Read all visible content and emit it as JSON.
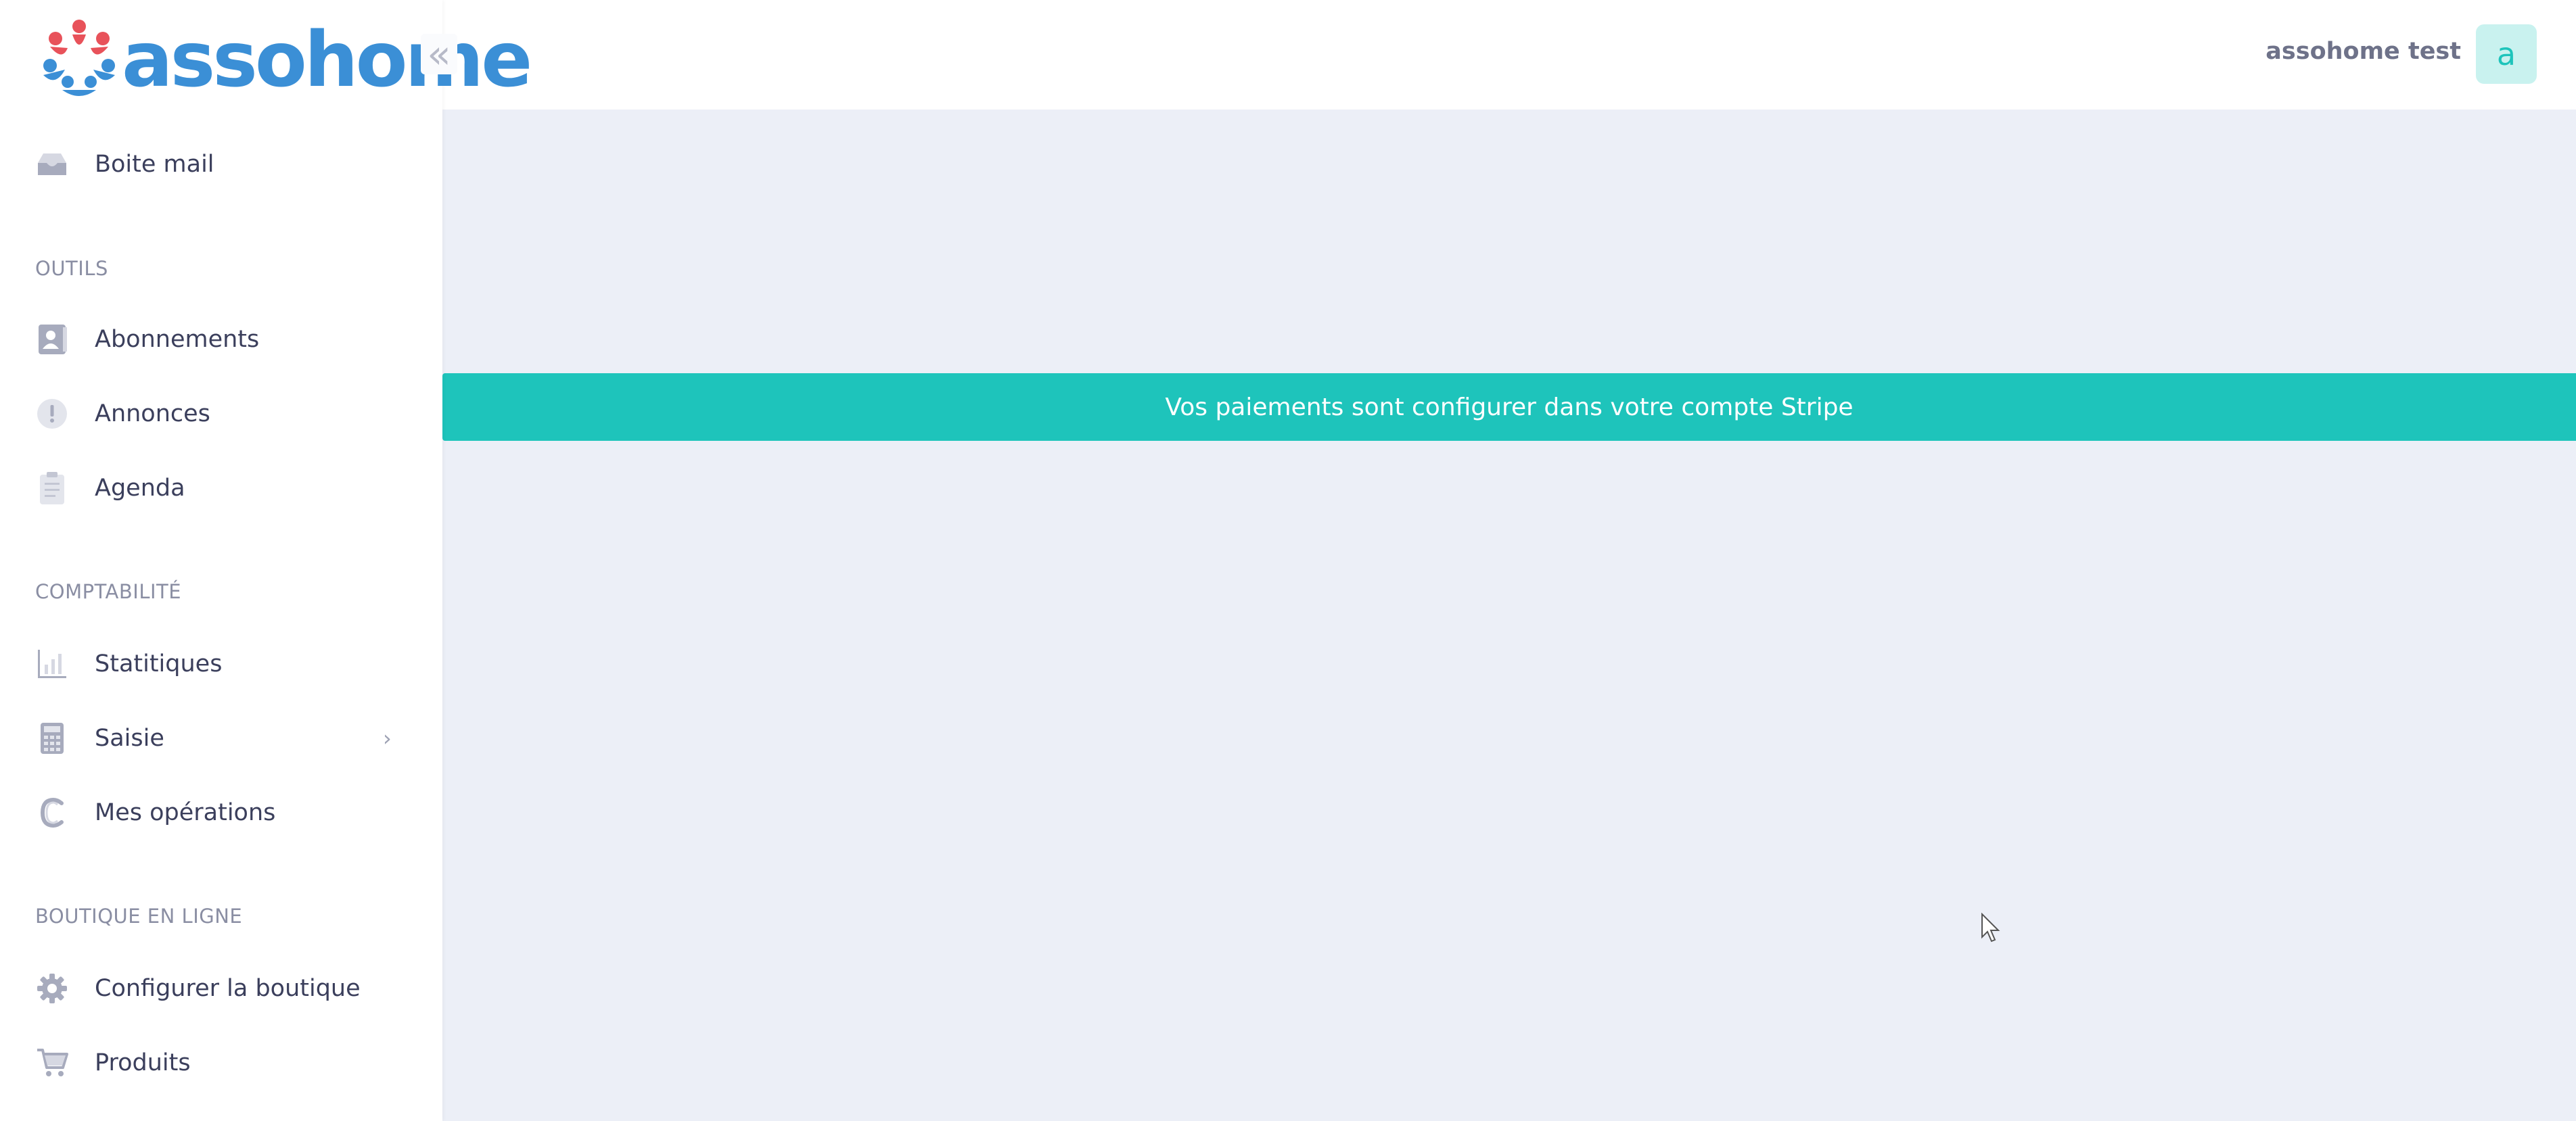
{
  "brand": {
    "logo_text": "assohome"
  },
  "header": {
    "user_name": "assohome test",
    "avatar_letter": "a"
  },
  "sidebar": {
    "top_items": [
      {
        "label": "Boite mail",
        "icon": "inbox-icon"
      }
    ],
    "sections": [
      {
        "title": "OUTILS",
        "items": [
          {
            "label": "Abonnements",
            "icon": "contact-card-icon"
          },
          {
            "label": "Annonces",
            "icon": "exclamation-circle-icon"
          },
          {
            "label": "Agenda",
            "icon": "clipboard-icon"
          }
        ]
      },
      {
        "title": "COMPTABILITÉ",
        "items": [
          {
            "label": "Statitiques",
            "icon": "bar-chart-icon"
          },
          {
            "label": "Saisie",
            "icon": "calculator-icon"
          },
          {
            "label": "Mes opérations",
            "icon": "euro-icon"
          }
        ]
      },
      {
        "title": "BOUTIQUE EN LIGNE",
        "items": [
          {
            "label": "Configurer la boutique",
            "icon": "gear-icon"
          },
          {
            "label": "Produits",
            "icon": "cart-icon"
          }
        ]
      }
    ]
  },
  "main": {
    "banner_text": "Vos paiements sont configurer dans votre compte Stripe"
  },
  "colors": {
    "accent": "#1ec4bb",
    "background": "#eceff7",
    "logo_blue": "#3b8fd6",
    "logo_red": "#e8525a"
  }
}
